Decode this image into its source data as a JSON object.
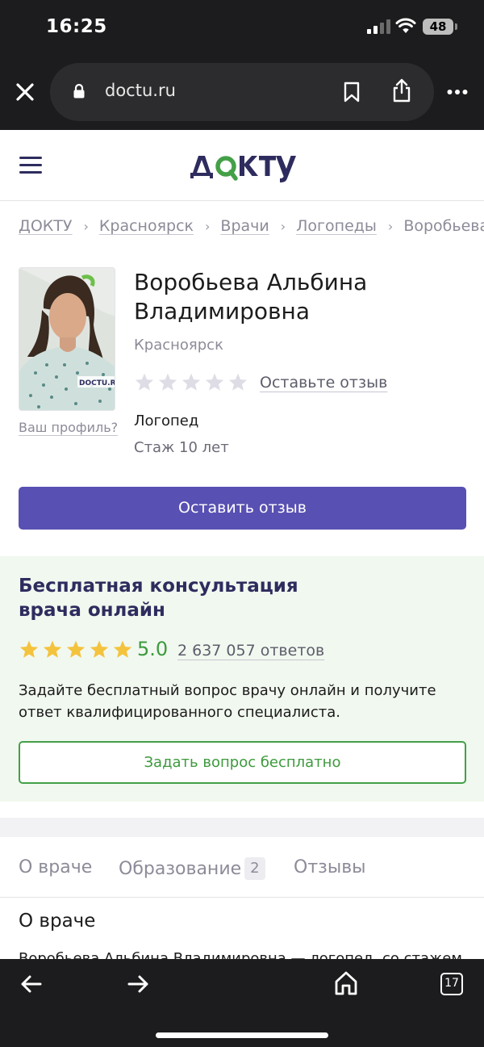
{
  "status_bar": {
    "time": "16:25",
    "battery": "48"
  },
  "browser": {
    "url": "doctu.ru",
    "tab_count": "17"
  },
  "site": {
    "logo_text": "ДОКТУ",
    "brand_color": "#2e2c5e",
    "accent_color": "#43a047"
  },
  "breadcrumb": [
    "ДОКТУ",
    "Красноярск",
    "Врачи",
    "Логопеды",
    "Воробьева"
  ],
  "breadcrumb_separator": "›",
  "doctor": {
    "name": "Воробьева Альбина Владимировна",
    "city": "Красноярск",
    "rating_stars_filled": 0,
    "rating_stars_total": 5,
    "review_link": "Оставьте отзыв",
    "specialty": "Логопед",
    "experience": "Стаж 10 лет",
    "profile_link": "Ваш профиль?",
    "photo_watermark": "DOCTU.RU"
  },
  "primary_button": "Оставить отзыв",
  "primary_color": "#5850b2",
  "consult": {
    "title": "Бесплатная консультация врача онлайн",
    "rating": "5.0",
    "stars_filled": 5,
    "answers": "2 637 057 ответов",
    "text": "Задайте бесплатный вопрос врачу онлайн и получите ответ квалифицированного специалиста.",
    "button": "Задать вопрос бесплатно"
  },
  "tabs": [
    {
      "label": "О враче"
    },
    {
      "label": "Образование",
      "badge": "2"
    },
    {
      "label": "Отзывы"
    }
  ],
  "about": {
    "title": "О враче",
    "text": "Воробьева Альбина Владимировна — логопед, со стажем"
  },
  "icons": [
    "close-icon",
    "lock-icon",
    "bookmark-icon",
    "share-icon",
    "more-icon",
    "menu-icon",
    "star-icon",
    "back-arrow-icon",
    "forward-arrow-icon",
    "home-icon",
    "tabs-icon"
  ]
}
